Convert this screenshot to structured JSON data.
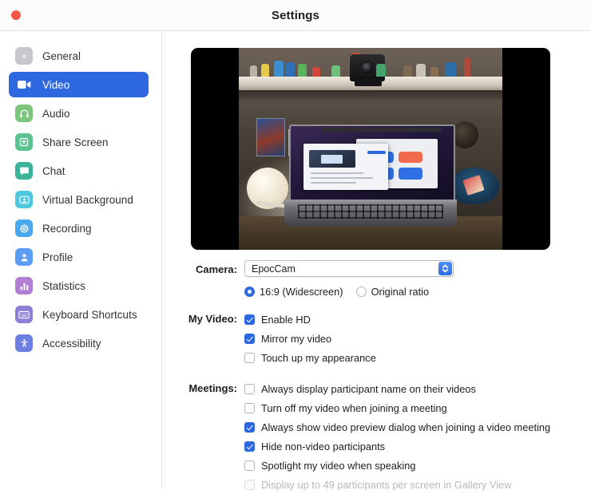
{
  "window": {
    "title": "Settings",
    "traffic_lights": [
      {
        "name": "close",
        "color": "#f5564a"
      }
    ]
  },
  "sidebar": {
    "items": [
      {
        "label": "General",
        "icon": "gear-icon",
        "color": "#c8c8cc",
        "active": false
      },
      {
        "label": "Video",
        "icon": "video-camera-icon",
        "color": "#2d68e0",
        "active": true
      },
      {
        "label": "Audio",
        "icon": "headphones-icon",
        "color": "#7bc67b",
        "active": false
      },
      {
        "label": "Share Screen",
        "icon": "share-screen-icon",
        "color": "#5cc48f",
        "active": false
      },
      {
        "label": "Chat",
        "icon": "chat-bubble-icon",
        "color": "#3bb39b",
        "active": false
      },
      {
        "label": "Virtual Background",
        "icon": "person-frame-icon",
        "color": "#4cc8e0",
        "active": false
      },
      {
        "label": "Recording",
        "icon": "record-circle-icon",
        "color": "#4aa8f0",
        "active": false
      },
      {
        "label": "Profile",
        "icon": "person-icon",
        "color": "#5b9cf5",
        "active": false
      },
      {
        "label": "Statistics",
        "icon": "bar-chart-icon",
        "color": "#b27fd4",
        "active": false
      },
      {
        "label": "Keyboard Shortcuts",
        "icon": "keyboard-icon",
        "color": "#8b7fd8",
        "active": false
      },
      {
        "label": "Accessibility",
        "icon": "accessibility-icon",
        "color": "#6d7fe0",
        "active": false
      }
    ]
  },
  "content": {
    "camera": {
      "label": "Camera:",
      "selected": "EpocCam",
      "stepper_icon": "chevron-up-down-icon"
    },
    "ratio": {
      "options": [
        {
          "label": "16:9 (Widescreen)",
          "checked": true
        },
        {
          "label": "Original ratio",
          "checked": false
        }
      ]
    },
    "my_video": {
      "label": "My Video:",
      "options": [
        {
          "label": "Enable HD",
          "checked": true,
          "disabled": false
        },
        {
          "label": "Mirror my video",
          "checked": true,
          "disabled": false
        },
        {
          "label": "Touch up my appearance",
          "checked": false,
          "disabled": false
        }
      ]
    },
    "meetings": {
      "label": "Meetings:",
      "options": [
        {
          "label": "Always display participant name on their videos",
          "checked": false,
          "disabled": false
        },
        {
          "label": "Turn off my video when joining a meeting",
          "checked": false,
          "disabled": false
        },
        {
          "label": "Always show video preview dialog when joining a video meeting",
          "checked": true,
          "disabled": false
        },
        {
          "label": "Hide non-video participants",
          "checked": true,
          "disabled": false
        },
        {
          "label": "Spotlight my video when speaking",
          "checked": false,
          "disabled": false
        },
        {
          "label": "Display up to 49 participants per screen in Gallery View",
          "checked": false,
          "disabled": true
        }
      ]
    },
    "video_preview": {
      "name": "camera-preview",
      "letterbox_color": "#000000",
      "description": "Live camera preview of a desk with a laptop, shelf of figurines and a webcam"
    }
  },
  "colors": {
    "accent": "#2d68e0",
    "text": "#1d1d1f",
    "disabled_text": "#b9b9bc",
    "border": "#e6e6e6"
  }
}
